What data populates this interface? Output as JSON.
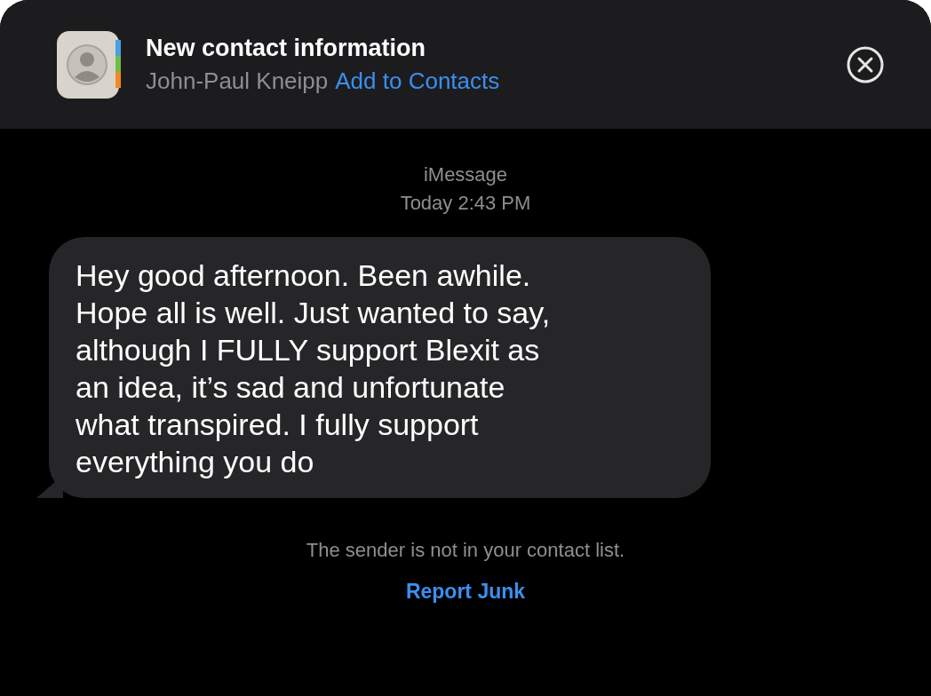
{
  "banner": {
    "title": "New contact information",
    "contact_name": "John-Paul Kneipp",
    "add_link": "Add to Contacts"
  },
  "thread": {
    "service": "iMessage",
    "timestamp": "Today 2:43 PM"
  },
  "messages": [
    {
      "kind": "received",
      "text": "Hey good afternoon. Been awhile.\nHope all is well. Just wanted to say,\nalthough I FULLY support Blexit as\nan idea, it’s sad and unfortunate\nwhat transpired. I fully support\neverything you do"
    }
  ],
  "notice": "The sender is not in your contact list.",
  "report_link": "Report Junk"
}
